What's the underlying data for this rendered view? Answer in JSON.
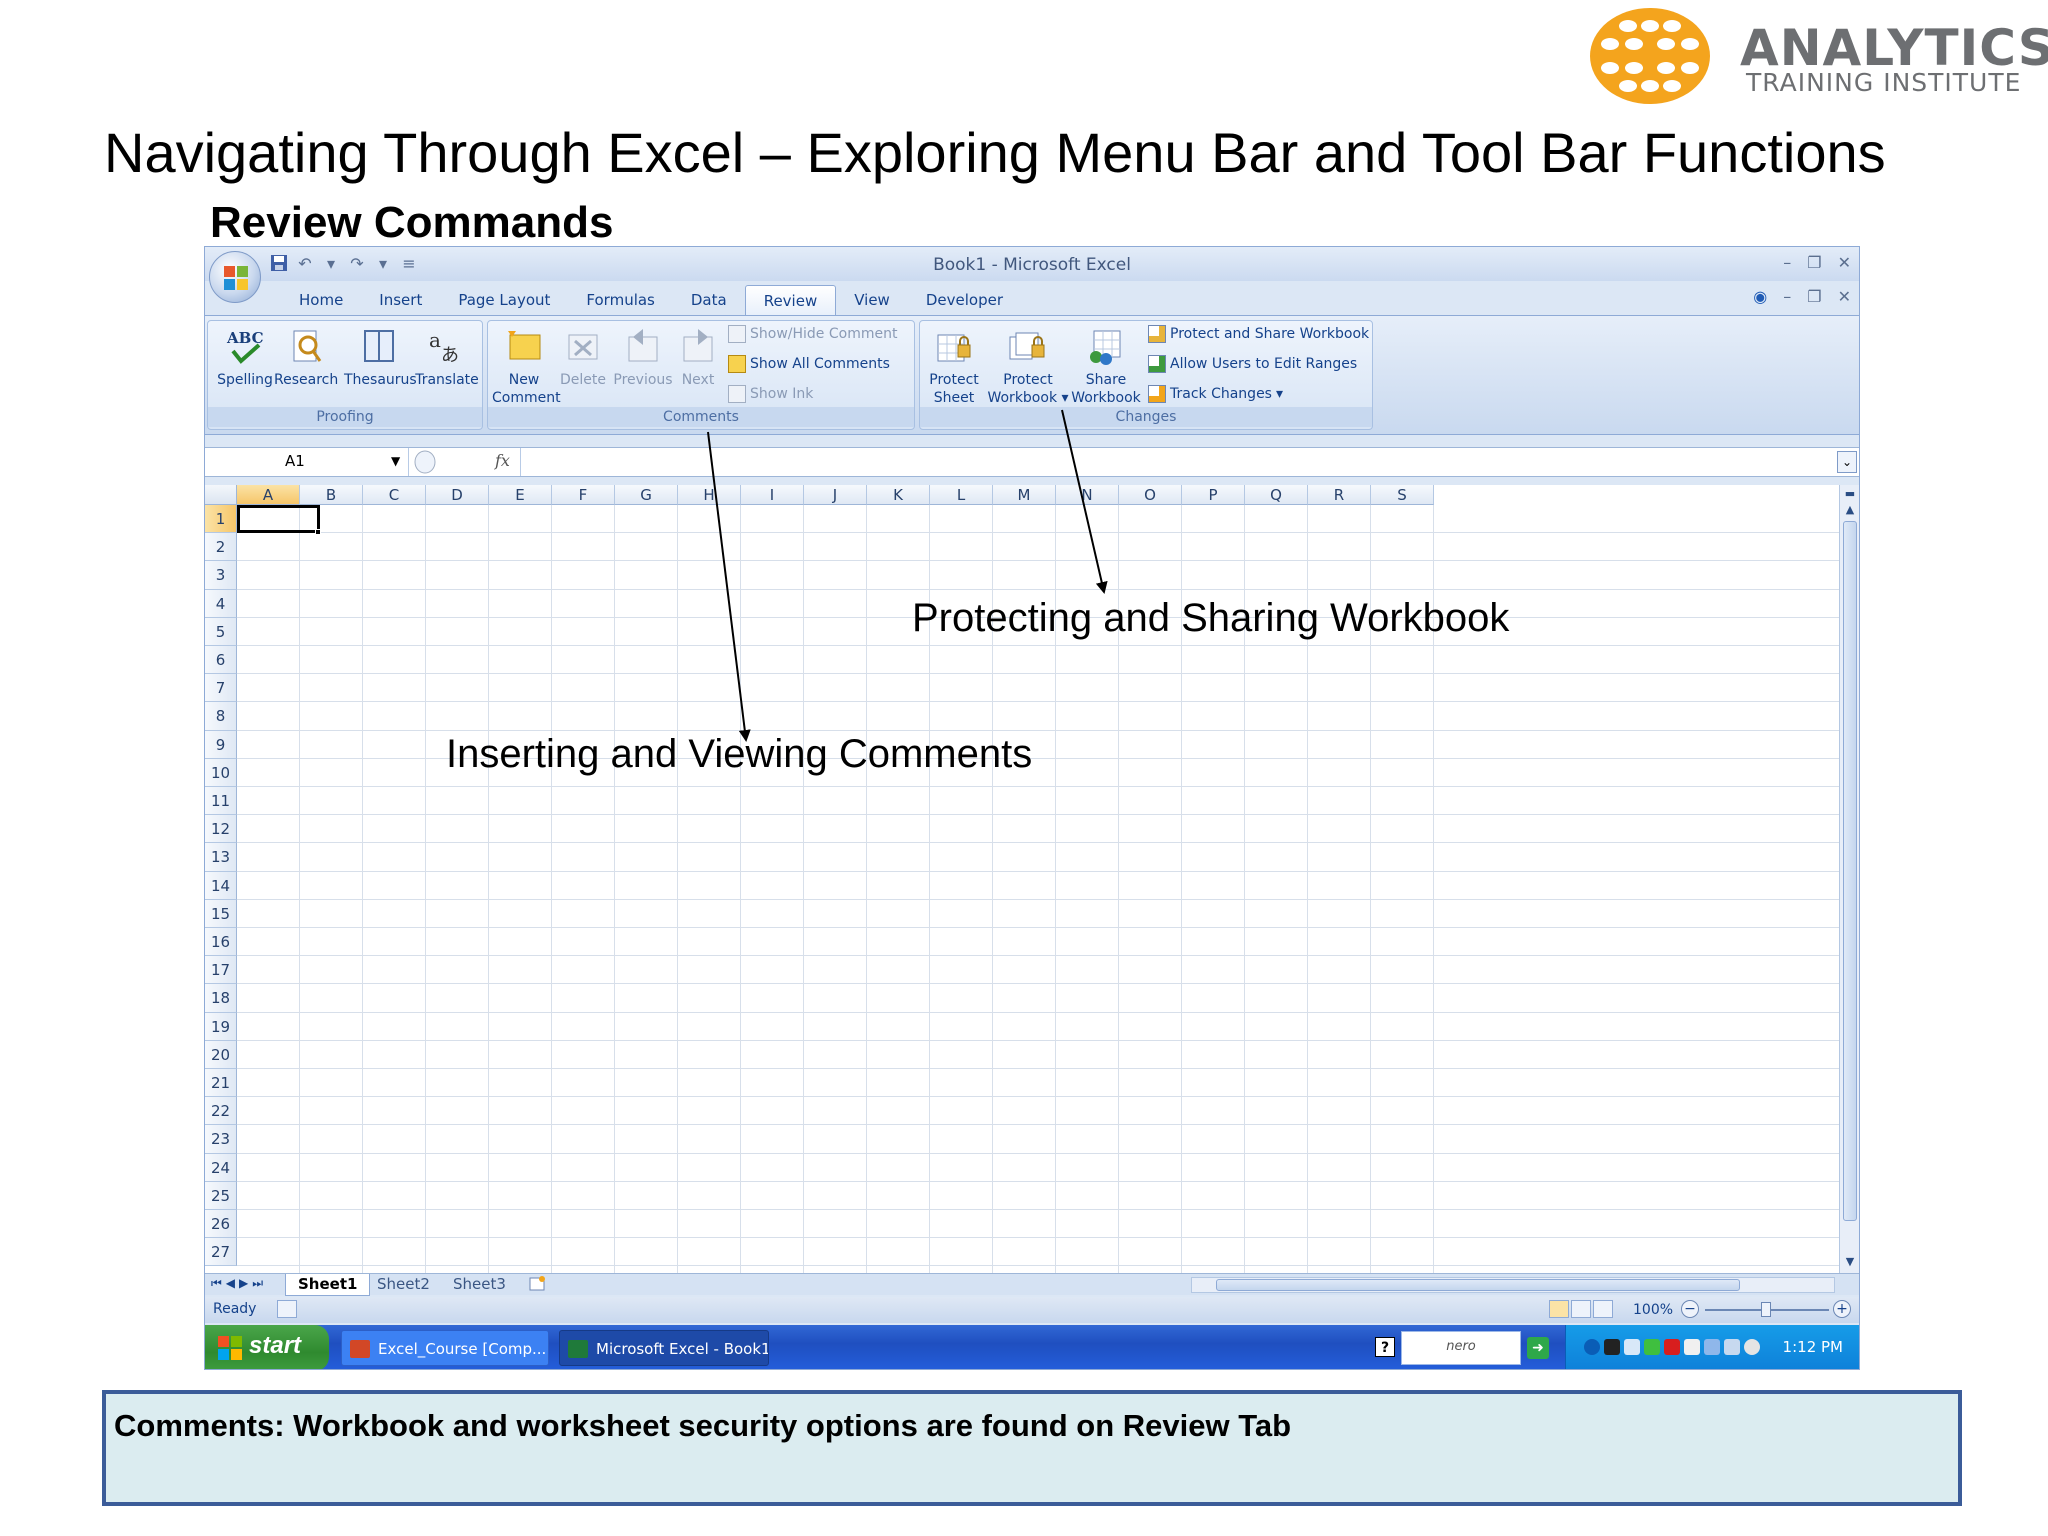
{
  "brand": {
    "name": "ANALYTICS",
    "tagline": "TRAINING INSTITUTE",
    "color": "#f4a41d"
  },
  "slide": {
    "title": "Navigating Through Excel – Exploring Menu Bar and Tool Bar Functions",
    "subtitle": "Review Commands"
  },
  "excel": {
    "window_title": "Book1 - Microsoft Excel",
    "window_controls": [
      "minimize-icon",
      "restore-icon",
      "close-icon"
    ],
    "quick_access": [
      "save-icon",
      "undo-icon",
      "redo-icon",
      "customize-icon"
    ],
    "tabs": [
      {
        "label": "Home"
      },
      {
        "label": "Insert"
      },
      {
        "label": "Page Layout"
      },
      {
        "label": "Formulas"
      },
      {
        "label": "Data"
      },
      {
        "label": "Review",
        "active": true
      },
      {
        "label": "View"
      },
      {
        "label": "Developer"
      }
    ],
    "ribbon": {
      "proofing": {
        "label": "Proofing",
        "buttons": [
          "Spelling",
          "Research",
          "Thesaurus",
          "Translate"
        ]
      },
      "comments": {
        "label": "Comments",
        "new_line1": "New",
        "new_line2": "Comment",
        "delete": "Delete",
        "previous": "Previous",
        "next": "Next",
        "show_hide": "Show/Hide Comment",
        "show_all": "Show All Comments",
        "show_ink": "Show Ink"
      },
      "changes": {
        "label": "Changes",
        "protect_sheet_line1": "Protect",
        "protect_sheet_line2": "Sheet",
        "protect_workbook_line1": "Protect",
        "protect_workbook_line2": "Workbook",
        "share_workbook_line1": "Share",
        "share_workbook_line2": "Workbook",
        "protect_share": "Protect and Share Workbook",
        "allow_users": "Allow Users to Edit Ranges",
        "track_changes": "Track Changes"
      }
    },
    "formula_bar": {
      "name_box": "A1",
      "fx": "fx",
      "value": ""
    },
    "columns": [
      "A",
      "B",
      "C",
      "D",
      "E",
      "F",
      "G",
      "H",
      "I",
      "J",
      "K",
      "L",
      "M",
      "N",
      "O",
      "P",
      "Q",
      "R",
      "S"
    ],
    "rows": [
      "1",
      "2",
      "3",
      "4",
      "5",
      "6",
      "7",
      "8",
      "9",
      "10",
      "11",
      "12",
      "13",
      "14",
      "15",
      "16",
      "17",
      "18",
      "19",
      "20",
      "21",
      "22",
      "23",
      "24",
      "25",
      "26",
      "27"
    ],
    "active_cell": "A1",
    "sheets": [
      {
        "label": "Sheet1",
        "active": true
      },
      {
        "label": "Sheet2"
      },
      {
        "label": "Sheet3"
      }
    ],
    "status": {
      "ready": "Ready",
      "zoom": "100%"
    }
  },
  "taskbar": {
    "start": "start",
    "tasks": [
      "Excel_Course [Comp...",
      "Microsoft Excel - Book1"
    ],
    "nero": "nero",
    "clock": "1:12 PM"
  },
  "callouts": {
    "protect": "Protecting and Sharing Workbook",
    "comments": "Inserting and Viewing Comments"
  },
  "comment_box": {
    "text": "Comments: Workbook and worksheet security options are found on Review Tab"
  }
}
